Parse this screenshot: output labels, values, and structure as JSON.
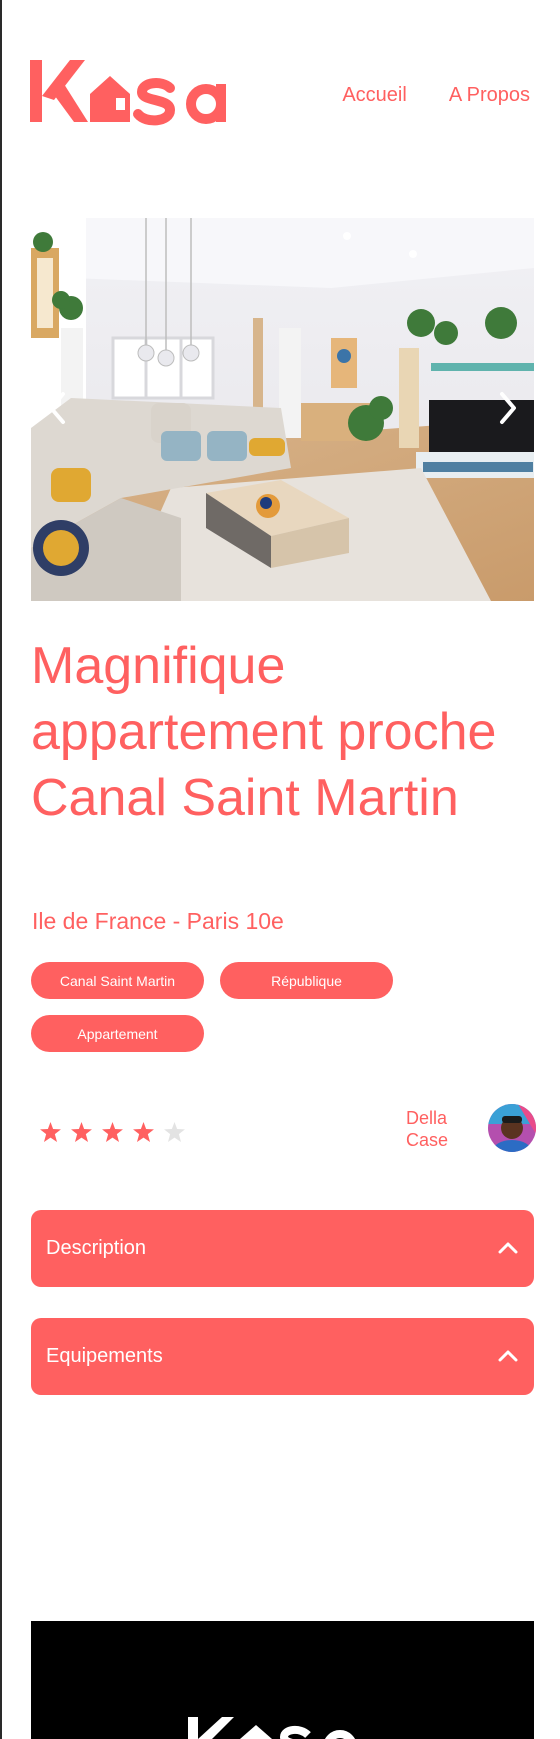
{
  "brand": {
    "name": "Kasa",
    "color": "#FF6060"
  },
  "nav": {
    "home": "Accueil",
    "about": "A Propos"
  },
  "carousel": {
    "prev_icon": "chevron-left-icon",
    "next_icon": "chevron-right-icon"
  },
  "listing": {
    "title": "Magnifique appartement proche Canal Saint Martin",
    "location": "Ile de France - Paris 10e",
    "tags": [
      "Canal Saint Martin",
      "République",
      "Appartement"
    ],
    "rating": 4,
    "rating_max": 5
  },
  "host": {
    "name": "Della Case"
  },
  "sections": {
    "description": "Description",
    "equipments": "Equipements"
  }
}
